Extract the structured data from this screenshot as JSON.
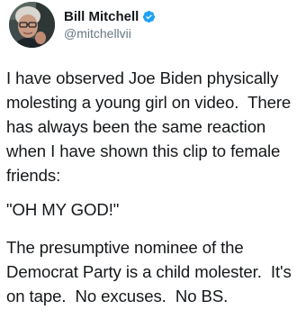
{
  "author": {
    "display_name": "Bill Mitchell",
    "handle": "@mitchellvii",
    "verified_icon": "verified-badge-icon",
    "verified_color": "#1da1f2"
  },
  "tweet": {
    "paragraph_1": "I have observed Joe Biden physically molesting a young girl on video.  There has always been the same reaction when I have shown this clip to female friends:",
    "paragraph_2": "\"OH MY GOD!\"",
    "paragraph_3": "The presumptive nominee of the Democrat Party is a child molester.  It's on tape.  No excuses.  No BS."
  },
  "colors": {
    "text": "#14171a",
    "secondary_text": "#657786",
    "accent": "#1da1f2"
  }
}
